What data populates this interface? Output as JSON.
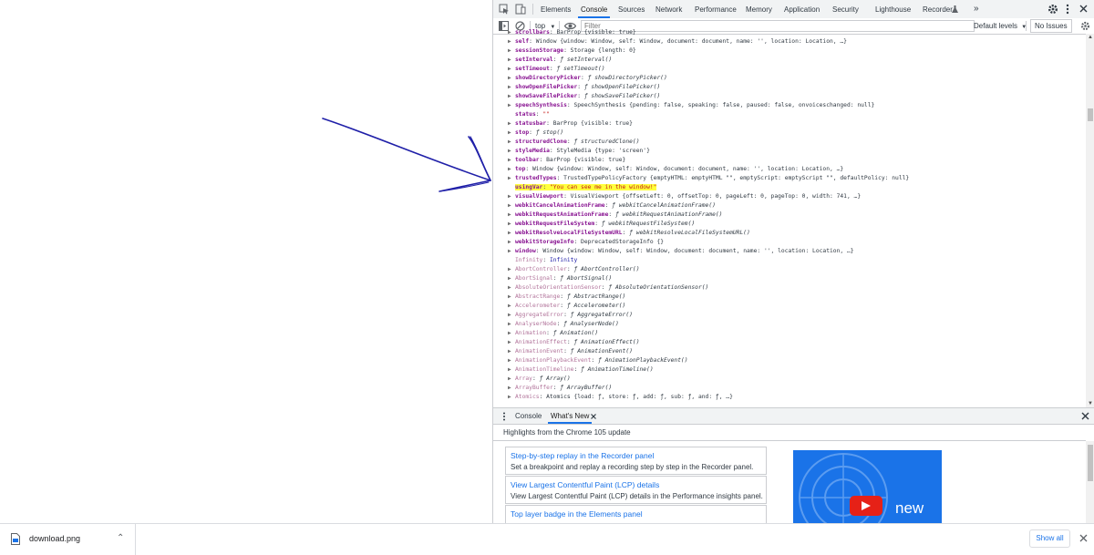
{
  "devtools": {
    "tabs": [
      "Elements",
      "Console",
      "Sources",
      "Network",
      "Performance",
      "Memory",
      "Application",
      "Security",
      "Lighthouse",
      "Recorder"
    ],
    "more_tabs_label": "»",
    "toolbar": {
      "context": "top",
      "filter_placeholder": "Filter",
      "levels": "Default levels",
      "issues": "No Issues"
    },
    "console_lines": [
      {
        "t": true,
        "key": "scrollbars",
        "val": "BarProp {visible: true}",
        "proto": false
      },
      {
        "t": true,
        "key": "self",
        "val": "Window {window: Window, self: Window, document: document, name: '', location: Location, …}",
        "proto": false
      },
      {
        "t": true,
        "key": "sessionStorage",
        "val": "Storage {length: 0}",
        "proto": false
      },
      {
        "t": true,
        "key": "setInterval",
        "val": "ƒ setInterval()",
        "proto": false
      },
      {
        "t": true,
        "key": "setTimeout",
        "val": "ƒ setTimeout()",
        "proto": false
      },
      {
        "t": true,
        "key": "showDirectoryPicker",
        "val": "ƒ showDirectoryPicker()",
        "proto": false
      },
      {
        "t": true,
        "key": "showOpenFilePicker",
        "val": "ƒ showOpenFilePicker()",
        "proto": false
      },
      {
        "t": true,
        "key": "showSaveFilePicker",
        "val": "ƒ showSaveFilePicker()",
        "proto": false
      },
      {
        "t": true,
        "key": "speechSynthesis",
        "val": "SpeechSynthesis {pending: false, speaking: false, paused: false, onvoiceschanged: null}",
        "proto": false
      },
      {
        "t": false,
        "key": "status",
        "val": "\"\"",
        "proto": false
      },
      {
        "t": true,
        "key": "statusbar",
        "val": "BarProp {visible: true}",
        "proto": false
      },
      {
        "t": true,
        "key": "stop",
        "val": "ƒ stop()",
        "proto": false
      },
      {
        "t": true,
        "key": "structuredClone",
        "val": "ƒ structuredClone()",
        "proto": false
      },
      {
        "t": true,
        "key": "styleMedia",
        "val": "StyleMedia {type: 'screen'}",
        "proto": false
      },
      {
        "t": true,
        "key": "toolbar",
        "val": "BarProp {visible: true}",
        "proto": false
      },
      {
        "t": true,
        "key": "top",
        "val": "Window {window: Window, self: Window, document: document, name: '', location: Location, …}",
        "proto": false
      },
      {
        "t": true,
        "key": "trustedTypes",
        "val": "TrustedTypePolicyFactory {emptyHTML: emptyHTML \"\", emptyScript: emptyScript \"\", defaultPolicy: null}",
        "proto": false
      },
      {
        "t": false,
        "key": "usingVar",
        "val": "\"You can see me in the window!\"",
        "proto": false,
        "highlight": true
      },
      {
        "t": true,
        "key": "visualViewport",
        "val": "VisualViewport {offsetLeft: 0, offsetTop: 0, pageLeft: 0, pageTop: 0, width: 741, …}",
        "proto": false
      },
      {
        "t": true,
        "key": "webkitCancelAnimationFrame",
        "val": "ƒ webkitCancelAnimationFrame()",
        "proto": false
      },
      {
        "t": true,
        "key": "webkitRequestAnimationFrame",
        "val": "ƒ webkitRequestAnimationFrame()",
        "proto": false
      },
      {
        "t": true,
        "key": "webkitRequestFileSystem",
        "val": "ƒ webkitRequestFileSystem()",
        "proto": false
      },
      {
        "t": true,
        "key": "webkitResolveLocalFileSystemURL",
        "val": "ƒ webkitResolveLocalFileSystemURL()",
        "proto": false
      },
      {
        "t": true,
        "key": "webkitStorageInfo",
        "val": "DeprecatedStorageInfo {}",
        "proto": false
      },
      {
        "t": true,
        "key": "window",
        "val": "Window {window: Window, self: Window, document: document, name: '', location: Location, …}",
        "proto": false
      },
      {
        "t": false,
        "key": "Infinity",
        "val": "Infinity",
        "proto": true
      },
      {
        "t": true,
        "key": "AbortController",
        "val": "ƒ AbortController()",
        "proto": true
      },
      {
        "t": true,
        "key": "AbortSignal",
        "val": "ƒ AbortSignal()",
        "proto": true
      },
      {
        "t": true,
        "key": "AbsoluteOrientationSensor",
        "val": "ƒ AbsoluteOrientationSensor()",
        "proto": true
      },
      {
        "t": true,
        "key": "AbstractRange",
        "val": "ƒ AbstractRange()",
        "proto": true
      },
      {
        "t": true,
        "key": "Accelerometer",
        "val": "ƒ Accelerometer()",
        "proto": true
      },
      {
        "t": true,
        "key": "AggregateError",
        "val": "ƒ AggregateError()",
        "proto": true
      },
      {
        "t": true,
        "key": "AnalyserNode",
        "val": "ƒ AnalyserNode()",
        "proto": true
      },
      {
        "t": true,
        "key": "Animation",
        "val": "ƒ Animation()",
        "proto": true
      },
      {
        "t": true,
        "key": "AnimationEffect",
        "val": "ƒ AnimationEffect()",
        "proto": true
      },
      {
        "t": true,
        "key": "AnimationEvent",
        "val": "ƒ AnimationEvent()",
        "proto": true
      },
      {
        "t": true,
        "key": "AnimationPlaybackEvent",
        "val": "ƒ AnimationPlaybackEvent()",
        "proto": true
      },
      {
        "t": true,
        "key": "AnimationTimeline",
        "val": "ƒ AnimationTimeline()",
        "proto": true
      },
      {
        "t": true,
        "key": "Array",
        "val": "ƒ Array()",
        "proto": true
      },
      {
        "t": true,
        "key": "ArrayBuffer",
        "val": "ƒ ArrayBuffer()",
        "proto": true
      },
      {
        "t": true,
        "key": "Atomics",
        "val": "Atomics {load: ƒ, store: ƒ, add: ƒ, sub: ƒ, and: ƒ, …}",
        "proto": true
      }
    ],
    "drawer": {
      "tabs": [
        "Console",
        "What's New"
      ],
      "header": "Highlights from the Chrome 105 update",
      "cards": [
        {
          "title": "Step-by-step replay in the Recorder panel",
          "desc": "Set a breakpoint and replay a recording step by step in the Recorder panel."
        },
        {
          "title": "View Largest Contentful Paint (LCP) details",
          "desc": "View Largest Contentful Paint (LCP) details in the Performance insights panel."
        },
        {
          "title": "Top layer badge in the Elements panel",
          "desc": ""
        }
      ],
      "video_label": "new"
    }
  },
  "download_bar": {
    "file_name": "download.png",
    "show_all": "Show all"
  },
  "colors": {
    "accent": "#1a73e8",
    "highlight": "#ffff3d",
    "arrow": "#1f1fa8"
  }
}
